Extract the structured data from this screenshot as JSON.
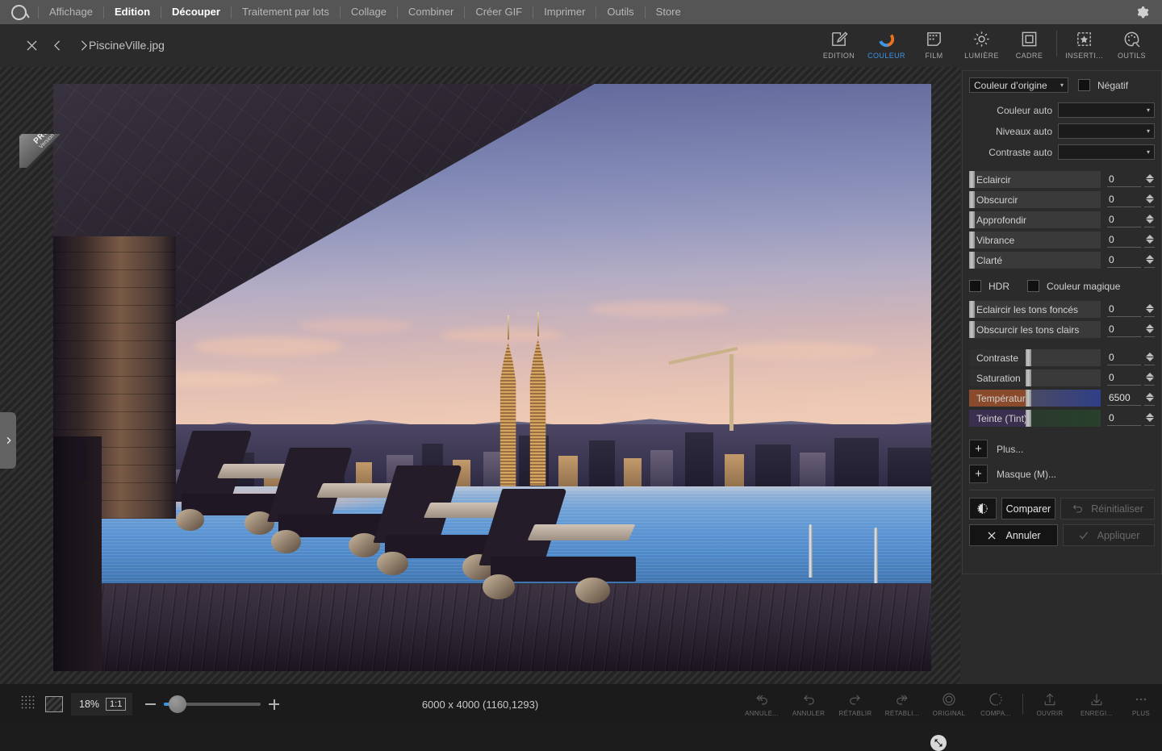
{
  "menubar": {
    "logo": "app-logo",
    "items": [
      {
        "label": "Affichage",
        "active": false
      },
      {
        "label": "Edition",
        "active": true
      },
      {
        "label": "Découper",
        "active": true
      },
      {
        "label": "Traitement par lots",
        "active": false
      },
      {
        "label": "Collage",
        "active": false
      },
      {
        "label": "Combiner",
        "active": false
      },
      {
        "label": "Créer GIF",
        "active": false
      },
      {
        "label": "Imprimer",
        "active": false
      },
      {
        "label": "Outils",
        "active": false
      },
      {
        "label": "Store",
        "active": false
      }
    ],
    "settings_icon": "gear-icon"
  },
  "titlebar": {
    "close_icon": "close-icon",
    "prev_icon": "chevron-left-icon",
    "next_icon": "chevron-right-icon",
    "filename": "PiscineVille.jpg",
    "tabs": [
      {
        "label": "EDITION",
        "icon": "pencil-square-icon",
        "selected": false
      },
      {
        "label": "COULEUR",
        "icon": "color-ring-icon",
        "selected": true
      },
      {
        "label": "FILM",
        "icon": "film-strip-icon",
        "selected": false
      },
      {
        "label": "LUMIÈRE",
        "icon": "sun-icon",
        "selected": false
      },
      {
        "label": "CADRE",
        "icon": "frame-icon",
        "selected": false
      },
      {
        "label": "INSERTI...",
        "icon": "star-insert-icon",
        "selected": false
      },
      {
        "label": "OUTILS",
        "icon": "palette-icon",
        "selected": false
      }
    ],
    "accent_color": "#3c96e8"
  },
  "canvas": {
    "pro_badge_line1": "PRO",
    "pro_badge_line2": "Version",
    "fit_icon": "fit-to-screen-icon",
    "side_handle_icon": "chevron-right-icon"
  },
  "panel": {
    "mode_select": {
      "value": "Couleur d’origine",
      "caret": "▾"
    },
    "negative": {
      "label": "Négatif",
      "checked": false
    },
    "auto_rows": [
      {
        "label": "Couleur auto",
        "value": ""
      },
      {
        "label": "Niveaux auto",
        "value": ""
      },
      {
        "label": "Contraste auto",
        "value": ""
      }
    ],
    "sliders_group1": [
      {
        "label": "Eclaircir",
        "value": "0",
        "style": "left"
      },
      {
        "label": "Obscurcir",
        "value": "0",
        "style": "left"
      },
      {
        "label": "Approfondir",
        "value": "0",
        "style": "left"
      },
      {
        "label": "Vibrance",
        "value": "0",
        "style": "left"
      },
      {
        "label": "Clarté",
        "value": "0",
        "style": "left"
      }
    ],
    "toggles": [
      {
        "label": "HDR",
        "checked": false
      },
      {
        "label": "Couleur magique",
        "checked": false
      }
    ],
    "sliders_group2": [
      {
        "label": "Eclaircir les tons foncés",
        "value": "0",
        "style": "left"
      },
      {
        "label": "Obscurcir les tons clairs",
        "value": "0",
        "style": "left"
      }
    ],
    "sliders_group3": [
      {
        "label": "Contraste",
        "value": "0",
        "style": "center",
        "grad_from": "#3a3a3a",
        "grad_to": "#3a3a3a",
        "label_bg": "#2f2f2f"
      },
      {
        "label": "Saturation",
        "value": "0",
        "style": "center",
        "grad_from": "#3a3a3a",
        "grad_to": "#3a3a3a",
        "label_bg": "#2f2f2f"
      },
      {
        "label": "Température",
        "value": "6500",
        "style": "center",
        "grad_from": "#4a4a62",
        "grad_to": "#2f3f87",
        "label_bg": "#8a4a2c"
      },
      {
        "label": "Teinte (Tint)",
        "value": "0",
        "style": "center",
        "grad_from": "#2a3a2e",
        "grad_to": "#28402c",
        "label_bg": "#3a2f4e"
      }
    ],
    "add_rows": [
      {
        "label": "Plus...",
        "icon": "plus-icon"
      },
      {
        "label": "Masque (M)...",
        "icon": "plus-icon"
      }
    ],
    "actions": {
      "split_view_icon": "split-compare-icon",
      "compare": "Comparer",
      "reset": "Réinitialiser",
      "reset_icon": "undo-arrow-icon",
      "cancel": "Annuler",
      "cancel_icon": "close-icon",
      "apply": "Appliquer",
      "apply_icon": "check-icon"
    }
  },
  "statusbar": {
    "grid_icon": "dotted-grid-icon",
    "checker_icon": "transparency-checker-icon",
    "zoom_percent": "18%",
    "ratio_label": "1:1",
    "minus_icon": "minus-icon",
    "plus_icon": "plus-icon",
    "dimensions": "6000 x 4000 (1160,1293)",
    "tools": [
      {
        "label": "ANNULE...",
        "icon": "undo-all-icon"
      },
      {
        "label": "ANNULER",
        "icon": "undo-icon"
      },
      {
        "label": "RÉTABLIR",
        "icon": "redo-icon"
      },
      {
        "label": "RÉTABLI...",
        "icon": "redo-all-icon"
      },
      {
        "label": "ORIGINAL",
        "icon": "original-circle-icon"
      },
      {
        "label": "COMPA...",
        "icon": "compare-half-circle-icon"
      },
      {
        "label": "OUVRIR",
        "icon": "upload-arrow-icon"
      },
      {
        "label": "ENREGI...",
        "icon": "download-arrow-icon"
      },
      {
        "label": "PLUS",
        "icon": "ellipsis-icon"
      }
    ]
  }
}
